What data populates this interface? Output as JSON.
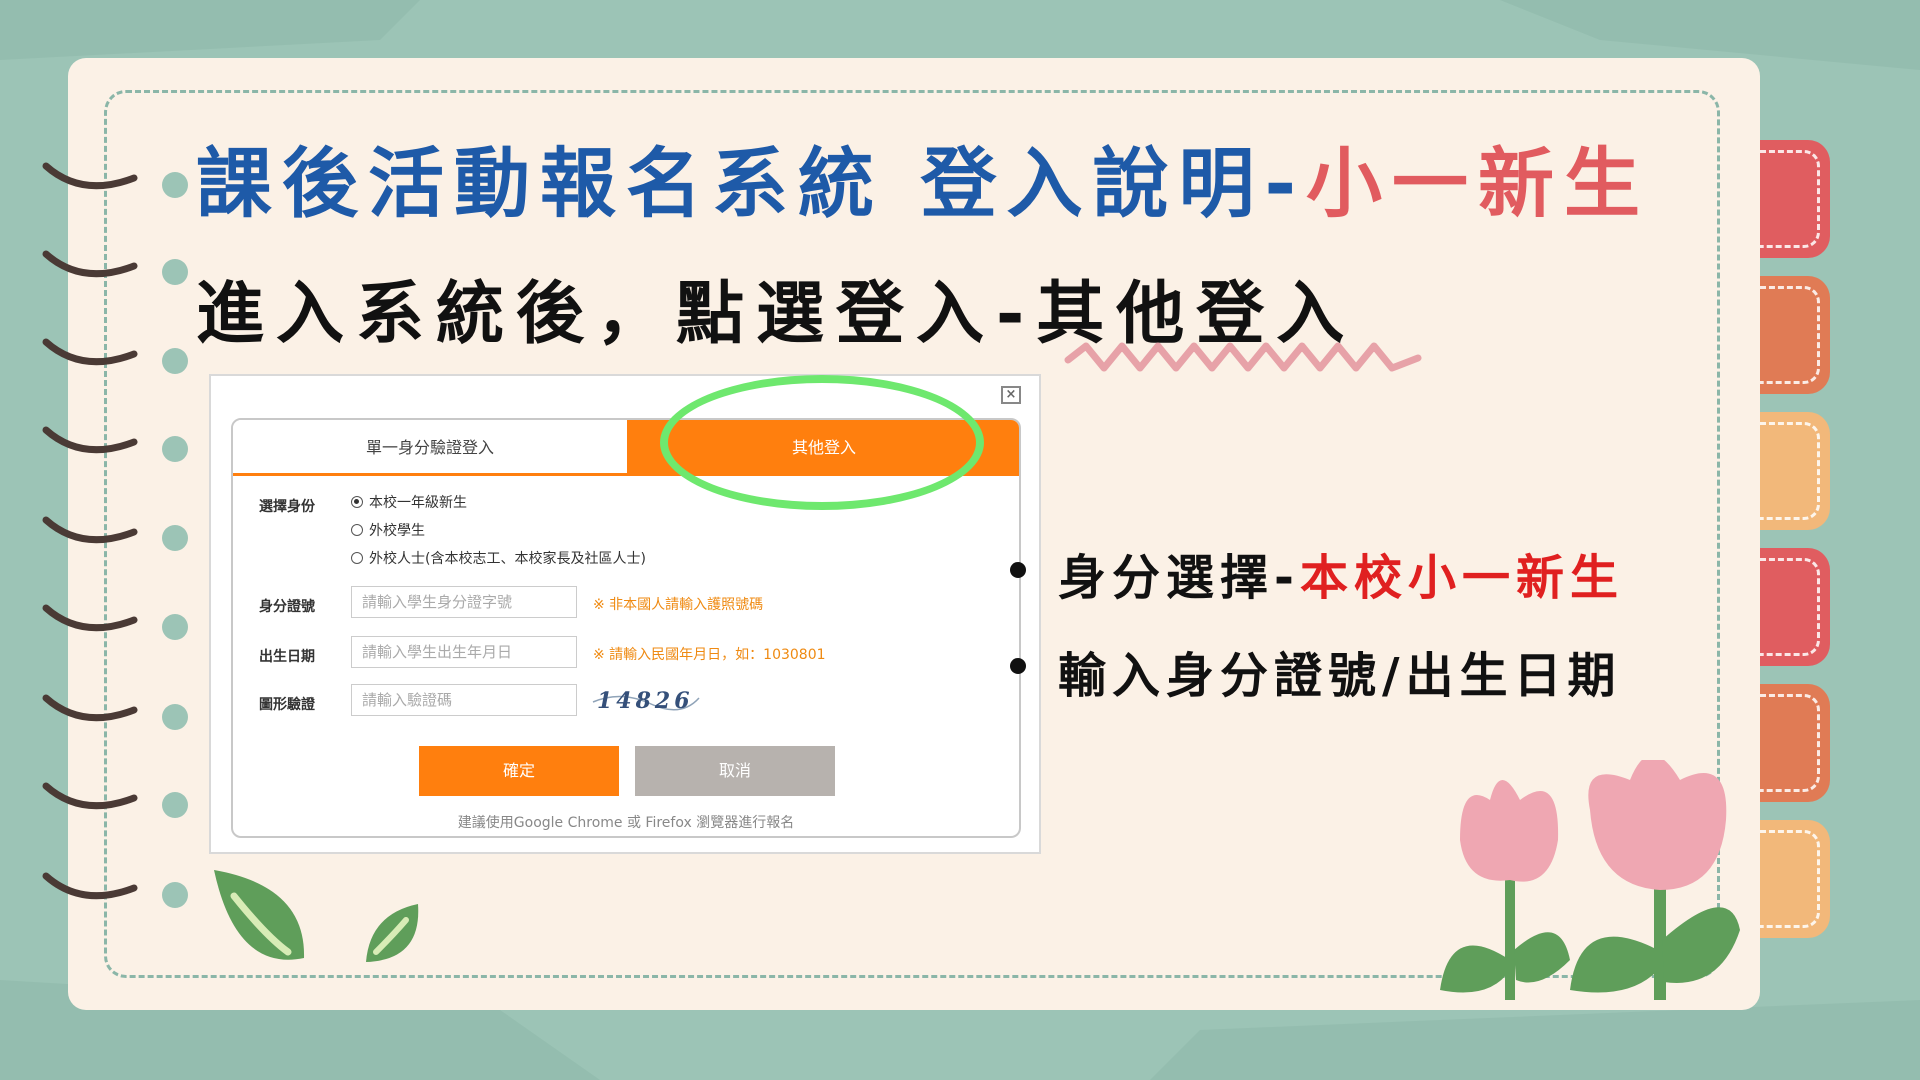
{
  "slide": {
    "title_main": "課後活動報名系統 登入說明-",
    "title_accent": "小一新生",
    "subtitle": "進入系統後，點選登入-其他登入",
    "bullets": [
      {
        "text": "身分選擇-",
        "highlight": "本校小一新生"
      },
      {
        "text": "輸入身分證號/出生日期",
        "highlight": ""
      }
    ]
  },
  "login_dialog": {
    "tabs": [
      "單一身分驗證登入",
      "其他登入"
    ],
    "active_tab": "其他登入",
    "identity_label": "選擇身份",
    "identity_options": [
      "本校一年級新生",
      "外校學生",
      "外校人士(含本校志工、本校家長及社區人士)"
    ],
    "identity_selected": "本校一年級新生",
    "id_label": "身分證號",
    "id_placeholder": "請輸入學生身分證字號",
    "id_hint": "※ 非本國人請輸入護照號碼",
    "dob_label": "出生日期",
    "dob_placeholder": "請輸入學生出生年月日",
    "dob_hint": "※ 請輸入民國年月日，如：1030801",
    "captcha_label": "圖形驗證",
    "captcha_placeholder": "請輸入驗證碼",
    "captcha_code": "14826",
    "confirm_label": "確定",
    "cancel_label": "取消",
    "footer_note": "建議使用Google Chrome 或 Firefox 瀏覽器進行報名"
  },
  "colors": {
    "title_blue": "#1e5aa8",
    "title_accent": "#e15b5f",
    "highlight_red": "#e02020",
    "orange": "#ff7f0e",
    "green_circle": "#6ee86e"
  }
}
